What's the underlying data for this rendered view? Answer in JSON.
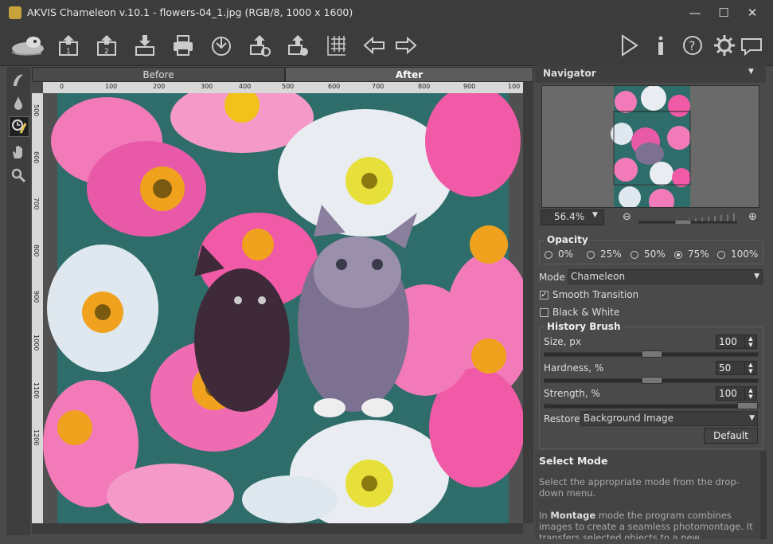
{
  "window": {
    "title": "AKVIS Chameleon v.10.1 - flowers-04_1.jpg (RGB/8, 1000 x 1600)",
    "minimize": "—",
    "maximize": "☐",
    "close": "✕"
  },
  "toolbar": {
    "items": [
      {
        "name": "logo-icon"
      },
      {
        "name": "open-image-1-icon",
        "label": "1"
      },
      {
        "name": "open-image-2-icon",
        "label": "2"
      },
      {
        "name": "save-icon"
      },
      {
        "name": "print-icon"
      },
      {
        "name": "share-icon"
      },
      {
        "name": "batch-icon"
      },
      {
        "name": "presets-icon"
      },
      {
        "name": "ruler-grid-icon"
      },
      {
        "name": "back-arrow-icon"
      },
      {
        "name": "forward-arrow-icon"
      },
      {
        "name": "run-icon"
      },
      {
        "name": "info-icon"
      },
      {
        "name": "help-icon"
      },
      {
        "name": "settings-icon"
      },
      {
        "name": "message-icon"
      }
    ]
  },
  "left_tools": [
    "brush-icon",
    "drop-icon",
    "history-brush-icon",
    "hand-icon",
    "zoom-icon"
  ],
  "tabs": {
    "before": "Before",
    "after": "After"
  },
  "ruler": {
    "top_labels": [
      "0",
      "100",
      "200",
      "300",
      "400",
      "500",
      "600",
      "700",
      "800",
      "900",
      "100"
    ],
    "left_labels": [
      "500",
      "600",
      "700",
      "800",
      "900",
      "1000",
      "1100",
      "1200"
    ]
  },
  "navigator": {
    "title": "Navigator",
    "zoom": "56.4%"
  },
  "opacity": {
    "title": "Opacity",
    "options": [
      "0%",
      "25%",
      "50%",
      "75%",
      "100%"
    ],
    "selected": "75%"
  },
  "mode": {
    "label": "Mode",
    "value": "Chameleon"
  },
  "smooth_transition": {
    "label": "Smooth Transition",
    "checked": "✓"
  },
  "black_white": {
    "label": "Black & White",
    "checked": ""
  },
  "history_brush": {
    "title": "History Brush",
    "size_label": "Size, px",
    "size_value": "100",
    "hardness_label": "Hardness, %",
    "hardness_value": "50",
    "strength_label": "Strength, %",
    "strength_value": "100",
    "restore_label": "Restore",
    "restore_value": "Background Image",
    "default_button": "Default"
  },
  "help": {
    "title": "Select Mode",
    "p1": "Select the appropriate mode from the drop-down menu.",
    "p2_bold": "Montage",
    "p2_pre": "In ",
    "p2_post": " mode the program combines images to create a seamless photomontage. It transfers selected objects to a new background"
  },
  "colors": {
    "bg": "#4a4a4a",
    "toolbar": "#3c3c3c",
    "flower_pink": "#e85aa8",
    "flower_white": "#dfe8ee"
  }
}
